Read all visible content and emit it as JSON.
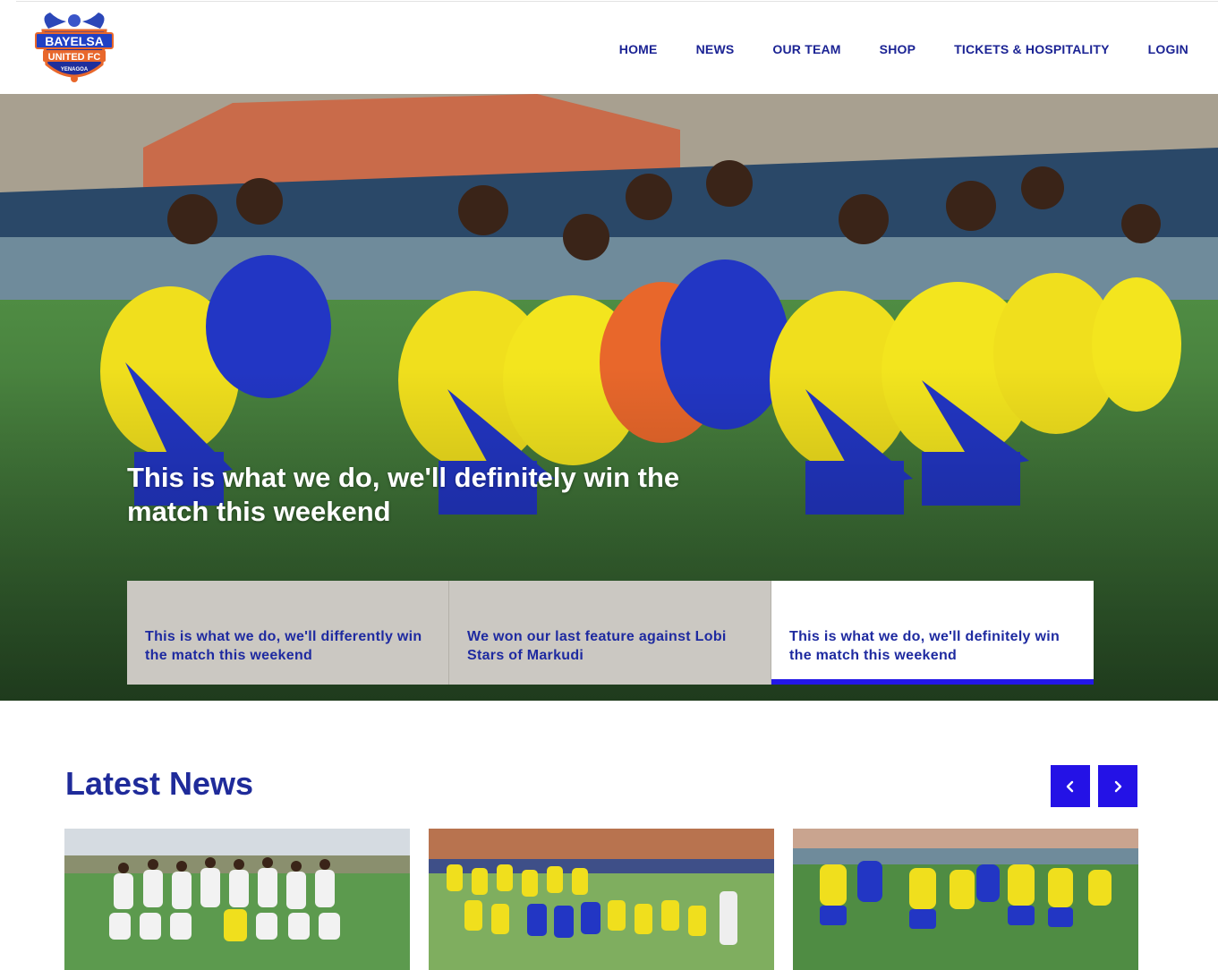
{
  "header": {
    "logo": {
      "line1": "BAYELSA",
      "line2": "UNITED FC",
      "line3": "YENAGOA"
    },
    "nav": [
      "HOME",
      "NEWS",
      "OUR TEAM",
      "SHOP",
      "TICKETS & HOSPITALITY",
      "LOGIN"
    ]
  },
  "hero": {
    "headline": "This is what we do, we'll definitely win the match this weekend",
    "tabs": [
      {
        "label": "This is what we do, we'll differently win the match this weekend",
        "active": false
      },
      {
        "label": "We won our last feature against Lobi Stars of Markudi",
        "active": false
      },
      {
        "label": "This is what we do, we'll definitely win the match this weekend",
        "active": true
      }
    ],
    "image": "team-training-photo"
  },
  "latest_news": {
    "title": "Latest News",
    "prev_icon": "chevron-left-icon",
    "next_icon": "chevron-right-icon",
    "cards": [
      {
        "image": "team-lineup-photo"
      },
      {
        "image": "team-warmup-photo"
      },
      {
        "image": "team-training-photo"
      }
    ]
  },
  "colors": {
    "brand_blue": "#1f2b9a",
    "accent": "#2412e6",
    "tab_grey": "#cbc8c2",
    "jersey_yellow": "#f2e41a"
  }
}
